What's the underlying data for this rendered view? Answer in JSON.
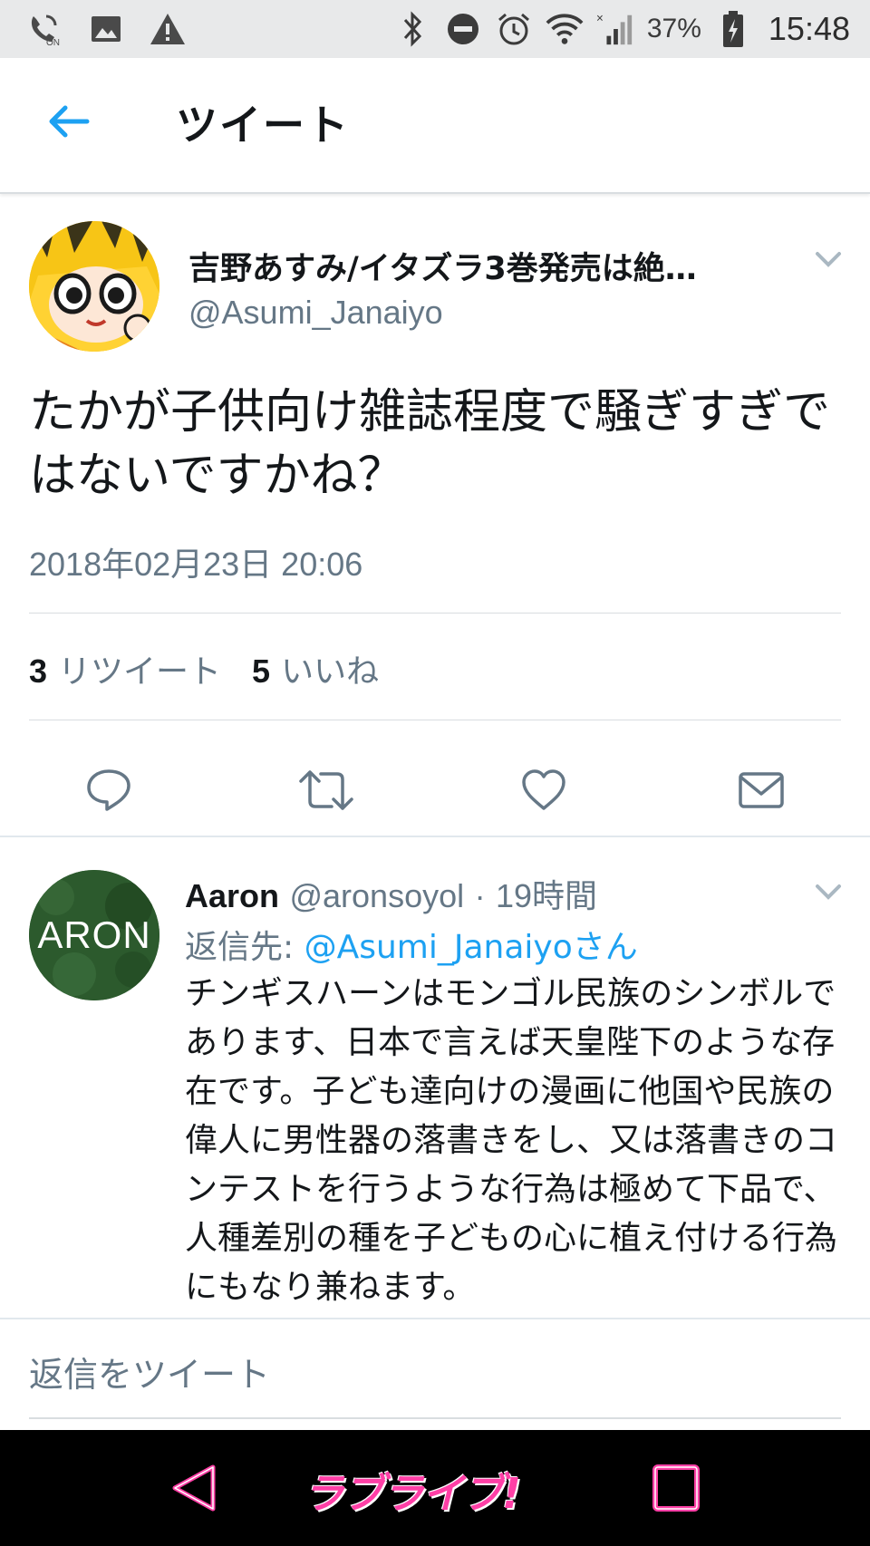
{
  "status_bar": {
    "battery": "37%",
    "time": "15:48",
    "icons": [
      "volte-icon",
      "image-icon",
      "warning-icon",
      "bluetooth-icon",
      "dnd-icon",
      "alarm-icon",
      "wifi-icon",
      "signal-icon",
      "battery-icon"
    ]
  },
  "header": {
    "title": "ツイート",
    "back_icon": "arrow-left-icon"
  },
  "tweet": {
    "author_name": "吉野あすみ/イタズラ3巻発売は絶…",
    "author_handle": "@Asumi_Janaiyo",
    "text": "たかが子供向け雑誌程度で騒ぎすぎではないですかね？",
    "timestamp": "2018年02月23日 20:06",
    "retweet_count": "3",
    "retweet_label": "リツイート",
    "like_count": "5",
    "like_label": "いいね",
    "actions": [
      "reply-icon",
      "retweet-icon",
      "like-icon",
      "share-icon"
    ]
  },
  "reply": {
    "avatar_text": "ARON",
    "name": "Aaron",
    "handle": "@aronsoyol",
    "separator": "·",
    "time": "19時間",
    "reply_to_label": "返信先:",
    "reply_to_link": "@Asumi_Janaiyoさん",
    "text": "チンギスハーンはモンゴル民族のシンボルであります、日本で言えば天皇陛下のような存在です。子ども達向けの漫画に他国や民族の偉人に男性器の落書きをし、又は落書きのコンテストを行うような行為は極めて下品で、人種差別の種を子どもの心に植え付ける行為にもなり兼ねます。"
  },
  "composer": {
    "placeholder": "返信をツイート"
  },
  "nav_bar": {
    "logo_text": "ラブライブ!",
    "color": "#ff3fa6"
  },
  "colors": {
    "accent": "#1da1f2",
    "secondary_text": "#657786",
    "primary_text": "#14171a"
  }
}
